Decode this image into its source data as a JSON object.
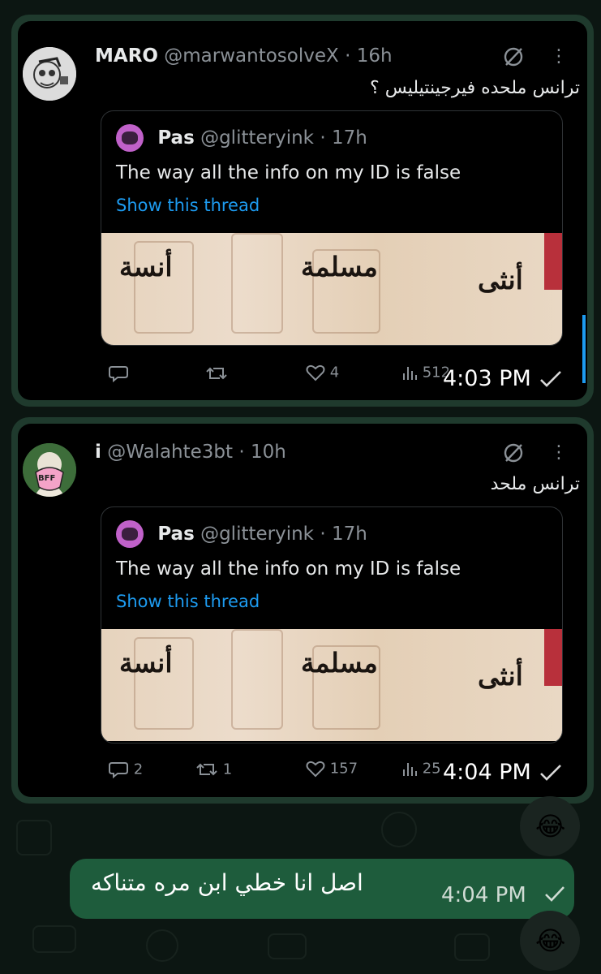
{
  "colors": {
    "bubble_border": "#1f3a2d",
    "link": "#1d9bf0",
    "outgoing_bubble": "#1e5c3c"
  },
  "messages": [
    {
      "author_name": "MARO",
      "author_handle": "@marwantosolveX",
      "author_age": "16h",
      "text": "ترانس ملحده فيرجينتيليس ؟",
      "quote": {
        "name": "Pas",
        "handle": "@glitteryink",
        "age": "17h",
        "text": "The way all the info on my ID is false",
        "link": "Show this thread",
        "image_words": [
          "أنثى",
          "مسلمة",
          "أنسة"
        ]
      },
      "actions": {
        "reply": "",
        "retweet": "",
        "like": "4",
        "views": "512"
      },
      "time": "4:03 PM"
    },
    {
      "author_name": "i",
      "author_handle": "@Walahte3bt",
      "author_age": "10h",
      "avatar_badge": "BFF",
      "text": "ترانس ملحد",
      "quote": {
        "name": "Pas",
        "handle": "@glitteryink",
        "age": "17h",
        "text": "The way all the info on my ID is false",
        "link": "Show this thread",
        "image_words": [
          "أنثى",
          "مسلمة",
          "أنسة"
        ]
      },
      "actions": {
        "reply": "2",
        "retweet": "1",
        "like": "157",
        "views": "25"
      },
      "time": "4:04 PM"
    }
  ],
  "reaction_emoji": "😂",
  "text_message": {
    "text": "اصل انا خطي ابن مره متناكه",
    "time": "4:04 PM"
  },
  "dot": "·"
}
